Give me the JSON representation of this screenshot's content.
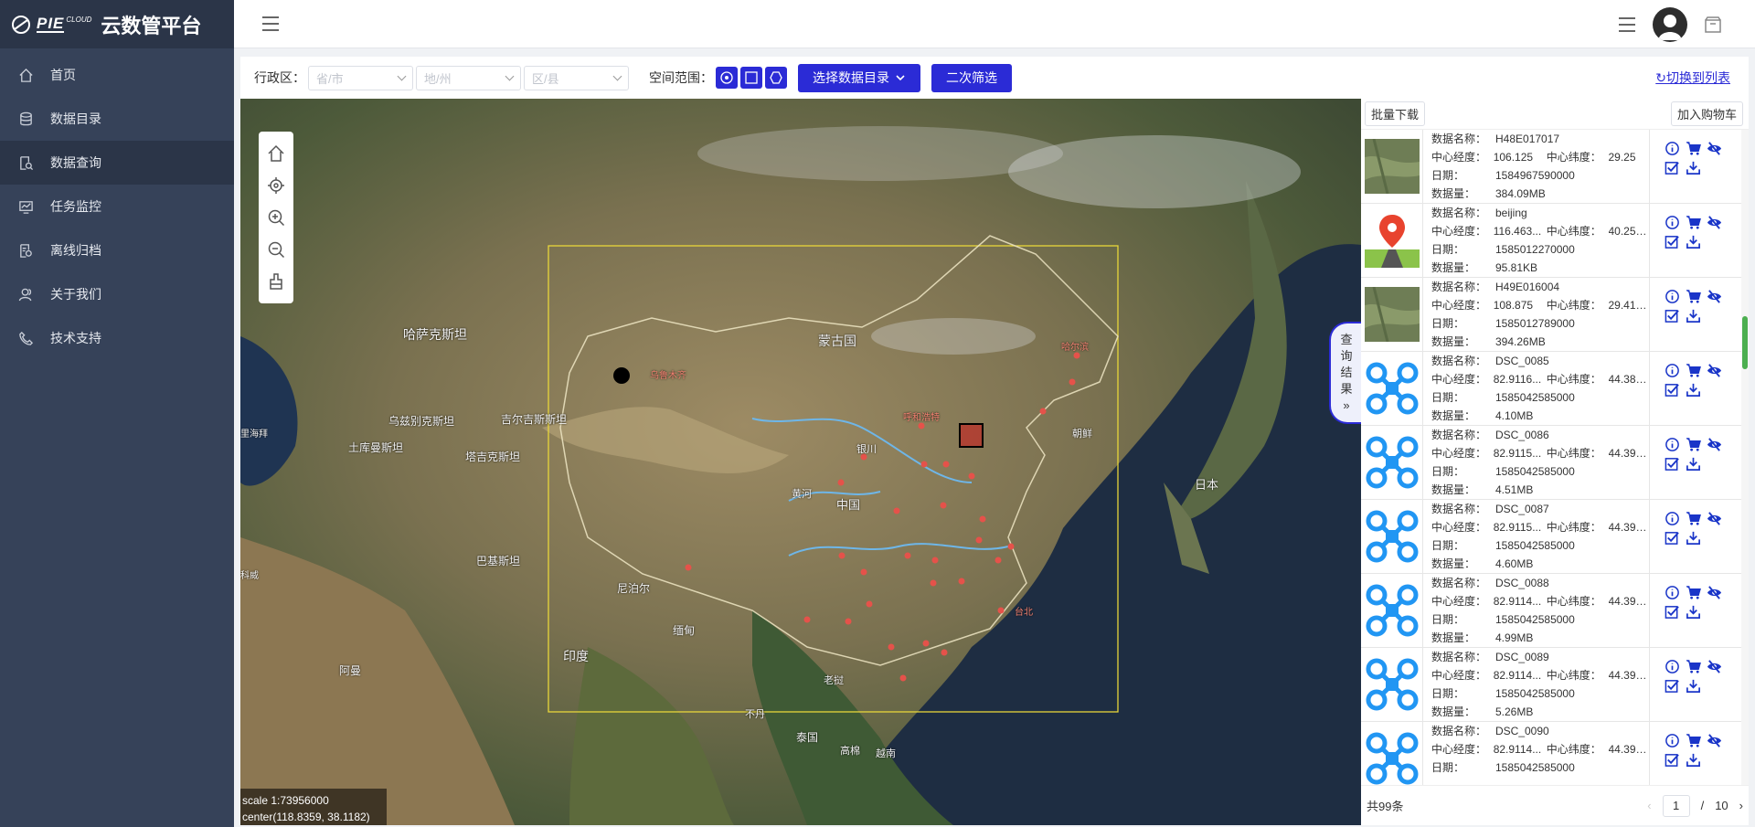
{
  "app": {
    "logo_text": "PIE",
    "logo_sub": "CLOUD",
    "title": "云数管平台"
  },
  "sidebar": {
    "items": [
      {
        "label": "首页",
        "icon": "home-icon",
        "active": false
      },
      {
        "label": "数据目录",
        "icon": "database-icon",
        "active": false
      },
      {
        "label": "数据查询",
        "icon": "search-doc-icon",
        "active": true
      },
      {
        "label": "任务监控",
        "icon": "monitor-icon",
        "active": false
      },
      {
        "label": "离线归档",
        "icon": "archive-icon",
        "active": false
      },
      {
        "label": "关于我们",
        "icon": "users-icon",
        "active": false
      },
      {
        "label": "技术支持",
        "icon": "phone-icon",
        "active": false
      }
    ]
  },
  "filters": {
    "region_label": "行政区：",
    "province_placeholder": "省/市",
    "city_placeholder": "地/州",
    "county_placeholder": "区/县",
    "space_label": "空间范围：",
    "select_catalog": "选择数据目录",
    "second_filter": "二次筛选",
    "switch_list": "切换到列表"
  },
  "map": {
    "labels": {
      "kazakhstan": "哈萨克斯坦",
      "mongolia": "蒙古国",
      "uzbekistan": "乌兹别克斯坦",
      "kyrgyzstan": "吉尔吉斯斯坦",
      "turkmenistan": "土库曼斯坦",
      "tajikistan": "塔吉克斯坦",
      "pakistan": "巴基斯坦",
      "nepal": "尼泊尔",
      "india": "印度",
      "myanmar": "缅甸",
      "china": "中国",
      "japan": "日本",
      "korea": "朝鲜",
      "oman": "阿曼",
      "laos": "老挝",
      "thailand": "泰国",
      "vietnam": "越南",
      "cambodia": "高棉",
      "urumqi": "乌鲁木齐",
      "huhehaote": "呼和浩特",
      "yinchuan": "银川",
      "huanghe": "黄河",
      "harbin": "哈尔滨",
      "taibei": "台北",
      "caspian": "里海拜",
      "saudi": "科威",
      "bhutan": "不丹"
    },
    "scale": "scale 1:73956000",
    "center": "center(118.8359, 38.1182)"
  },
  "results": {
    "batch_download": "批量下载",
    "add_cart": "加入购物车",
    "tab_label": [
      "查",
      "询",
      "结",
      "果",
      "»"
    ],
    "labels": {
      "name": "数据名称：",
      "lon": "中心经度：",
      "lat": "中心纬度：",
      "date": "日期：",
      "size": "数据量："
    },
    "items": [
      {
        "thumb": "satellite",
        "name": "H48E017017",
        "lon": "106.125",
        "lat": "29.25",
        "date": "1584967590000",
        "size": "384.09MB"
      },
      {
        "thumb": "pin",
        "name": "beijing",
        "lon": "116.463...",
        "lat": "40.251...",
        "date": "1585012270000",
        "size": "95.81KB"
      },
      {
        "thumb": "satellite",
        "name": "H49E016004",
        "lon": "108.875",
        "lat": "29.416...",
        "date": "1585012789000",
        "size": "394.26MB"
      },
      {
        "thumb": "drone",
        "name": "DSC_0085",
        "lon": "82.9116...",
        "lat": "44.389...",
        "date": "1585042585000",
        "size": "4.10MB"
      },
      {
        "thumb": "drone",
        "name": "DSC_0086",
        "lon": "82.9115...",
        "lat": "44.390...",
        "date": "1585042585000",
        "size": "4.51MB"
      },
      {
        "thumb": "drone",
        "name": "DSC_0087",
        "lon": "82.9115...",
        "lat": "44.390...",
        "date": "1585042585000",
        "size": "4.60MB"
      },
      {
        "thumb": "drone",
        "name": "DSC_0088",
        "lon": "82.9114...",
        "lat": "44.391...",
        "date": "1585042585000",
        "size": "4.99MB"
      },
      {
        "thumb": "drone",
        "name": "DSC_0089",
        "lon": "82.9114...",
        "lat": "44.391...",
        "date": "1585042585000",
        "size": "5.26MB"
      },
      {
        "thumb": "drone",
        "name": "DSC_0090",
        "lon": "82.9114...",
        "lat": "44.392...",
        "date": "1585042585000",
        "size": ""
      }
    ],
    "total": "共99条",
    "page_current": "1",
    "page_sep": "/",
    "page_total": "10"
  },
  "colors": {
    "accent": "#2b2bd6",
    "sidebar": "#364259",
    "active": "#2b3548",
    "action_icon": "#1a35c8"
  }
}
